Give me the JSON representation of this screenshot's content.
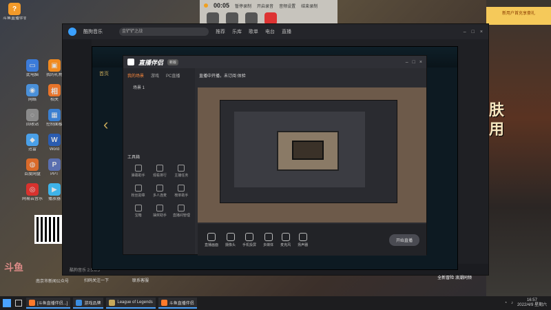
{
  "desktop": {
    "top_left_icon_label": "斗鱼直播伴侣",
    "icons": [
      {
        "label": "此电脑",
        "color": "#3b7bd9",
        "glyph": "▭"
      },
      {
        "label": "我的礼物",
        "color": "#f08a20",
        "glyph": "▣"
      },
      {
        "label": "网络",
        "color": "#4a90d9",
        "glyph": "◉"
      },
      {
        "label": "相关",
        "color": "#e8742a",
        "glyph": "相"
      },
      {
        "label": "回收站",
        "color": "#8a8a8a",
        "glyph": "◌"
      },
      {
        "label": "控制面板",
        "color": "#3a7fd0",
        "glyph": "▦"
      },
      {
        "label": "迅雷",
        "color": "#4aa0e8",
        "glyph": "◆"
      },
      {
        "label": "Word",
        "color": "#2b5caf",
        "glyph": "W"
      },
      {
        "label": "百度网盘",
        "color": "#d96a2a",
        "glyph": "◍"
      },
      {
        "label": "PPT",
        "color": "#5a6fb0",
        "glyph": "P"
      },
      {
        "label": "网易云音乐",
        "color": "#d8322e",
        "glyph": "◎"
      },
      {
        "label": "播放器",
        "color": "#3fb3e8",
        "glyph": "▶"
      }
    ],
    "watermark": "斗鱼",
    "footer_texts": [
      "南京市新闻公众号",
      "扫码关注一下",
      "联系客服"
    ]
  },
  "recorder": {
    "time": "00:05",
    "buttons": [
      "暂停录制",
      "开启录音",
      "音频设置",
      "结束录制"
    ]
  },
  "music_window": {
    "app_name": "酷狗音乐",
    "search_placeholder": "金铲铲之战",
    "tabs": [
      "推荐",
      "乐库",
      "歌单",
      "电台",
      "直播"
    ],
    "footer": "酷狗音乐 2.5.6.5"
  },
  "lol_window": {
    "nav": "首页"
  },
  "live_window": {
    "brand": "直播伴侣",
    "badge": "新版",
    "scene_tabs": [
      "我的场景",
      "游戏",
      "PC直播"
    ],
    "scene_item": "场景 1",
    "tools_title": "工具箱",
    "tools": [
      "弹幕助手",
      "观看排行",
      "主播任务",
      "粉丝勋章",
      "多人连麦",
      "榜单助手",
      "宝箱",
      "抽奖助手",
      "直播间管理"
    ],
    "right_head": "直播中开播，未订阅   体验",
    "controls": [
      "直播画面",
      "摄像头",
      "手机投屏",
      "多媒体",
      "麦克风",
      "扬声器"
    ],
    "start_label": "开始直播"
  },
  "ads": {
    "top_yellow": "新用户首充享豪礼",
    "big1": "肤",
    "big2": "用",
    "banner": "全新冒险 浪潮同频"
  },
  "taskbar": {
    "tasks": [
      {
        "label": "[斗鱼直播伴侣...]",
        "color": "#ff7a2a"
      },
      {
        "label": "游戏品牌",
        "color": "#3a8de0"
      },
      {
        "label": "League of Legends",
        "color": "#c8a95a"
      },
      {
        "label": "斗鱼直播伴侣",
        "color": "#ff7a2a"
      }
    ],
    "time": "16:57",
    "date": "2022/4/9 星期六"
  }
}
